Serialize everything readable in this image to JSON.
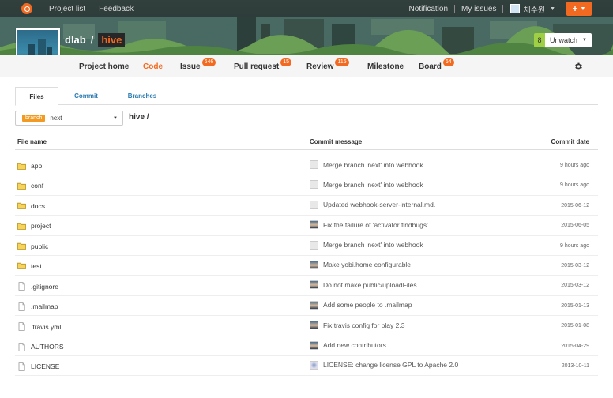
{
  "topbar": {
    "links": [
      "Project list",
      "Feedback"
    ],
    "notification": "Notification",
    "my_issues": "My issues",
    "user_name": "채수원",
    "plus": "+"
  },
  "project": {
    "owner": "dlab",
    "slash": "/",
    "repo": "hive"
  },
  "watch": {
    "count": "8",
    "label": "Unwatch"
  },
  "nav": [
    {
      "label": "Project home",
      "badge": null,
      "active": false
    },
    {
      "label": "Code",
      "badge": null,
      "active": true
    },
    {
      "label": "Issue",
      "badge": "646",
      "active": false
    },
    {
      "label": "Pull request",
      "badge": "15",
      "active": false
    },
    {
      "label": "Review",
      "badge": "115",
      "active": false
    },
    {
      "label": "Milestone",
      "badge": null,
      "active": false
    },
    {
      "label": "Board",
      "badge": "64",
      "active": false
    }
  ],
  "tabs": [
    {
      "label": "Files",
      "active": true
    },
    {
      "label": "Commit",
      "active": false
    },
    {
      "label": "Branches",
      "active": false
    }
  ],
  "branch": {
    "label": "branch",
    "name": "next"
  },
  "path": "hive /",
  "table": {
    "headers": {
      "name": "File name",
      "message": "Commit message",
      "date": "Commit date"
    },
    "rows": [
      {
        "type": "folder",
        "name": "app",
        "message": "Merge branch 'next' into webhook",
        "date": "9 hours ago",
        "avatar": "gray"
      },
      {
        "type": "folder",
        "name": "conf",
        "message": "Merge branch 'next' into webhook",
        "date": "9 hours ago",
        "avatar": "gray"
      },
      {
        "type": "folder",
        "name": "docs",
        "message": "Updated webhook-server-internal.md.",
        "date": "2015-06-12",
        "avatar": "gray"
      },
      {
        "type": "folder",
        "name": "project",
        "message": "Fix the failure of 'activator findbugs'",
        "date": "2015-06-05",
        "avatar": "photo"
      },
      {
        "type": "folder",
        "name": "public",
        "message": "Merge branch 'next' into webhook",
        "date": "9 hours ago",
        "avatar": "gray"
      },
      {
        "type": "folder",
        "name": "test",
        "message": "Make yobi.home configurable",
        "date": "2015-03-12",
        "avatar": "photo"
      },
      {
        "type": "file",
        "name": ".gitignore",
        "message": "Do not make public/uploadFiles",
        "date": "2015-03-12",
        "avatar": "photo"
      },
      {
        "type": "file",
        "name": ".mailmap",
        "message": "Add some people to .mailmap",
        "date": "2015-01-13",
        "avatar": "photo"
      },
      {
        "type": "file",
        "name": ".travis.yml",
        "message": "Fix travis config for play 2.3",
        "date": "2015-01-08",
        "avatar": "photo"
      },
      {
        "type": "file",
        "name": "AUTHORS",
        "message": "Add new contributors",
        "date": "2015-04-29",
        "avatar": "photo"
      },
      {
        "type": "file",
        "name": "LICENSE",
        "message": "LICENSE: change license GPL to Apache 2.0",
        "date": "2013-10-11",
        "avatar": "pattern"
      }
    ]
  },
  "colors": {
    "accent": "#f26a21",
    "link": "#2a7ab0",
    "watch_count": "#9fcf44"
  }
}
